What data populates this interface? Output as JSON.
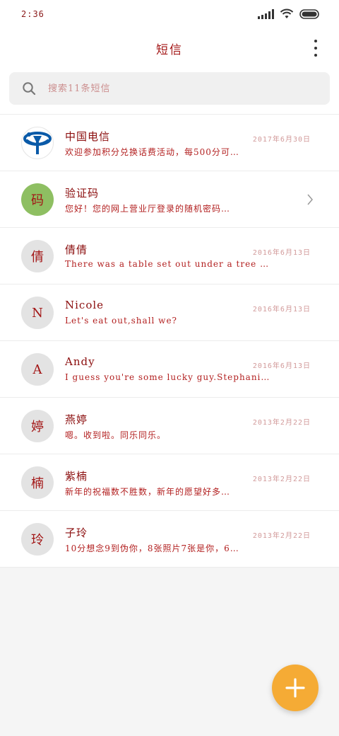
{
  "status_bar": {
    "time": "2:36"
  },
  "header": {
    "title": "短信"
  },
  "search": {
    "placeholder": "搜索11条短信"
  },
  "conversations": [
    {
      "name": "中国电信",
      "date": "2017年6月30日",
      "preview": "欢迎参加积分兑换话费活动，每500分可…",
      "avatar_text": "",
      "avatar_type": "logo"
    },
    {
      "name": "验证码",
      "date": "",
      "preview": "您好！您的网上营业厅登录的随机密码…",
      "avatar_text": "码",
      "avatar_type": "green"
    },
    {
      "name": "倩倩",
      "date": "2016年6月13日",
      "preview": "There was a table set out under a tree …",
      "avatar_text": "倩",
      "avatar_type": "grey"
    },
    {
      "name": "Nicole",
      "date": "2016年6月13日",
      "preview": "Let's eat out,shall we?",
      "avatar_text": "N",
      "avatar_type": "grey"
    },
    {
      "name": "Andy",
      "date": "2016年6月13日",
      "preview": "I guess you're some lucky guy.Stephani…",
      "avatar_text": "A",
      "avatar_type": "grey"
    },
    {
      "name": "燕婷",
      "date": "2013年2月22日",
      "preview": "嗯。收到啦。同乐同乐。",
      "avatar_text": "婷",
      "avatar_type": "grey"
    },
    {
      "name": "紫楠",
      "date": "2013年2月22日",
      "preview": "新年的祝福数不胜数，新年的愿望好多…",
      "avatar_text": "楠",
      "avatar_type": "grey"
    },
    {
      "name": "子玲",
      "date": "2013年2月22日",
      "preview": "10分想念9到伪你，8张照片7张是你，6…",
      "avatar_text": "玲",
      "avatar_type": "grey"
    }
  ],
  "colors": {
    "fab": "#f5ab35",
    "title": "#a31616",
    "green_avatar": "#8ebf62"
  }
}
